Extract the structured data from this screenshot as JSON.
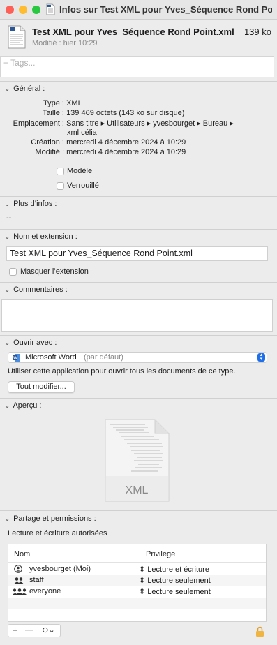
{
  "window": {
    "title": "Infos sur Test XML pour Yves_Séquence Rond Point.xml"
  },
  "header": {
    "name": "Test XML pour Yves_Séquence Rond Point.xml",
    "size": "139 ko",
    "modified": "Modifié : hier 10:29"
  },
  "tags": {
    "placeholder": "+ Tags..."
  },
  "general": {
    "title": "Général :",
    "type_label": "Type :",
    "type_value": "XML",
    "size_label": "Taille :",
    "size_value": "139 469 octets (143 ko sur disque)",
    "location_label": "Emplacement :",
    "location_value_1": "Sans titre ▸ Utilisateurs ▸ yvesbourget ▸ Bureau ▸",
    "location_value_2": "xml célia",
    "created_label": "Création :",
    "created_value": "mercredi 4 décembre 2024 à 10:29",
    "modified_label": "Modifié :",
    "modified_value": "mercredi 4 décembre 2024 à 10:29",
    "template_label": "Modèle",
    "locked_label": "Verrouillé"
  },
  "more_info": {
    "title": "Plus d’infos :",
    "value": "--"
  },
  "name_ext": {
    "title": "Nom et extension :",
    "filename": "Test XML pour Yves_Séquence Rond Point.xml",
    "hide_ext_label": "Masquer l’extension"
  },
  "comments": {
    "title": "Commentaires :"
  },
  "open_with": {
    "title": "Ouvrir avec :",
    "app_name": "Microsoft Word",
    "app_default": "(par défaut)",
    "description": "Utiliser cette application pour ouvrir tous les documents de ce type.",
    "change_all_label": "Tout modifier..."
  },
  "preview": {
    "title": "Aperçu :",
    "file_type_label": "XML"
  },
  "sharing": {
    "title": "Partage et permissions :",
    "status": "Lecture et écriture autorisées",
    "col_name": "Nom",
    "col_privilege": "Privilège",
    "rows": [
      {
        "name": "yvesbourget (Moi)",
        "privilege": "Lecture et écriture",
        "icon": "user-icon"
      },
      {
        "name": "staff",
        "privilege": "Lecture seulement",
        "icon": "group-icon"
      },
      {
        "name": "everyone",
        "privilege": "Lecture seulement",
        "icon": "everyone-icon"
      }
    ],
    "add_label": "+",
    "remove_label": "—"
  },
  "colors": {
    "close": "#fe5f57",
    "minimize": "#febc2e",
    "zoom": "#28c840",
    "word_blue": "#2b5797",
    "accent": "#1f6feb"
  }
}
